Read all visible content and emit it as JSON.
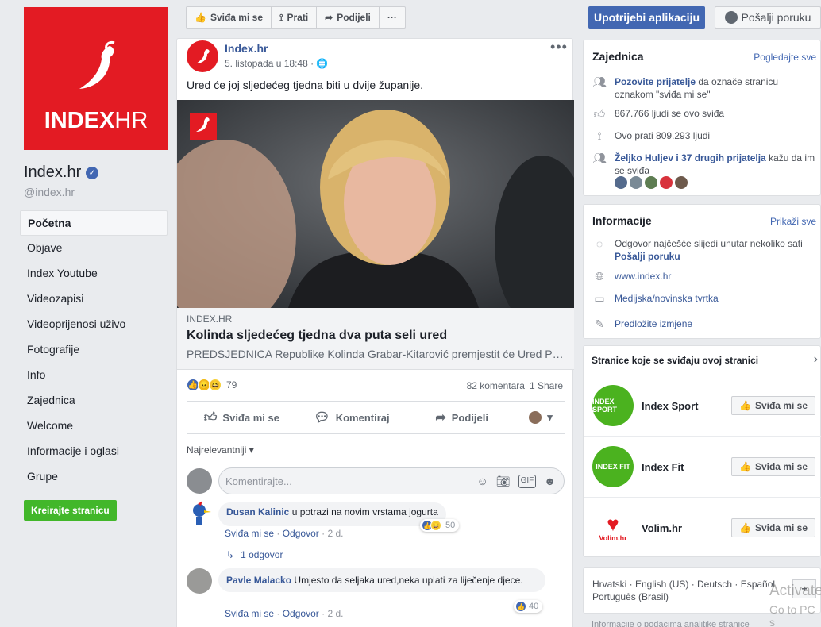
{
  "page": {
    "name": "Index.hr",
    "handle": "@index.hr",
    "logo_text_a": "INDEX",
    "logo_text_b": "HR"
  },
  "nav": {
    "items": [
      "Početna",
      "Objave",
      "Index Youtube",
      "Videozapisi",
      "Videoprijenosi uživo",
      "Fotografije",
      "Info",
      "Zajednica",
      "Welcome",
      "Informacije i oglasi",
      "Grupe"
    ],
    "active": "Početna",
    "create_page": "Kreirajte stranicu"
  },
  "actionbar": {
    "like": "Sviđa mi se",
    "follow": "Prati",
    "share": "Podijeli",
    "more": "···",
    "use_app": "Upotrijebi aplikaciju",
    "send_message": "Pošalji poruku"
  },
  "post": {
    "author": "Index.hr",
    "time": "5. listopada u 18:48 ·",
    "more": "•••",
    "text": "Ured će joj sljedećeg tjedna biti u dvije županije.",
    "link_source": "INDEX.HR",
    "link_title": "Kolinda sljedećeg tjedna dva puta seli ured",
    "link_desc": "PREDSJEDNICA Republike Kolinda Grabar-Kitarović premjestit će Ured Predsjednice",
    "reaction_count": "79",
    "comments_count": "82 komentara",
    "shares_count": "1 Share",
    "actions": {
      "like": "Sviđa mi se",
      "comment": "Komentiraj",
      "share": "Podijeli"
    },
    "sort": "Najrelevantniji ▾",
    "comment_placeholder": "Komentirajte..."
  },
  "comments": [
    {
      "name": "Dusan Kalinic",
      "text": "u potrazi na novim vrstama jogurta",
      "like": "Sviđa mi se",
      "reply": "Odgovor",
      "age": "2 d.",
      "reactions": "50",
      "replies": "1 odgovor"
    },
    {
      "name": "Pavle Malacko",
      "text": "Umjesto da seljaka ured,neka uplati za liječenje djece.",
      "like": "Sviđa mi se",
      "reply": "Odgovor",
      "age": "2 d.",
      "reactions": "40"
    }
  ],
  "community": {
    "title": "Zajednica",
    "see_all": "Pogledajte sve",
    "invite_link": "Pozovite prijatelje",
    "invite_rest": "da označe stranicu oznakom \"sviđa mi se\"",
    "likes": "867.766 ljudi se ovo sviđa",
    "follows": "Ovo prati 809.293 ljudi",
    "friends_link": "Željko Huljev i 37 drugih prijatelja",
    "friends_rest": "kažu da im se sviđa"
  },
  "info": {
    "title": "Informacije",
    "see_all": "Prikaži sve",
    "response": "Odgovor najčešće slijedi unutar nekoliko sati",
    "send_message": "Pošalji poruku",
    "website": "www.index.hr",
    "category": "Medijska/novinska tvrtka",
    "suggest": "Predložite izmjene"
  },
  "liked_pages": {
    "title": "Stranice koje se sviđaju ovoj stranici",
    "button": "Sviđa mi se",
    "pages": [
      {
        "name": "Index Sport",
        "logo": "INDEX SPORT",
        "color": "#4bb21f"
      },
      {
        "name": "Index Fit",
        "logo": "INDEX FIT",
        "color": "#4bb21f"
      },
      {
        "name": "Volim.hr",
        "logo": "Volim.hr",
        "color": "#e31b23"
      }
    ]
  },
  "languages": {
    "line1": "Hrvatski · English (US) · Deutsch · Español",
    "line2": "Português (Brasil)",
    "add": "+"
  },
  "overlay": {
    "activate": "Activate",
    "go_to": "Go to PC s",
    "footer": "Informacije o podacima analitike stranice"
  }
}
